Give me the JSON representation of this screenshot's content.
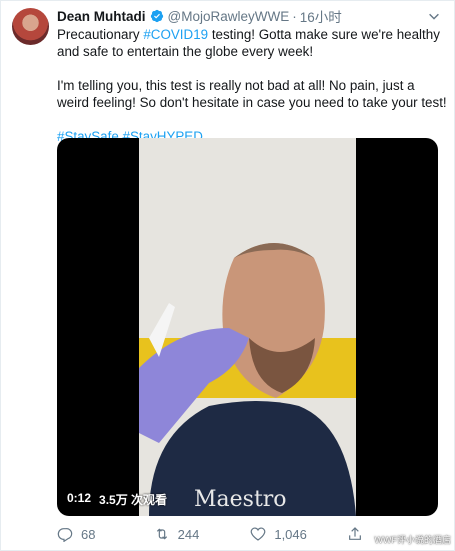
{
  "tweet": {
    "author_name": "Dean Muhtadi",
    "handle": "@MojoRawleyWWE",
    "separator": "·",
    "time": "16小时",
    "text": {
      "p1_before": "Precautionary ",
      "p1_hashtag": "#COVID19",
      "p1_after": " testing! Gotta make sure we're healthy and safe to entertain the globe every week!",
      "p2": "I'm telling you, this test is really not bad at all! No pain, just a weird feeling! So don't hesitate in case you need to take your test!",
      "hashtag1": "#StaySafe",
      "hashtag2": "#StayHYPED"
    }
  },
  "video": {
    "duration": "0:12",
    "views": "3.5万 次观看",
    "shirt_text": "Maestro"
  },
  "actions": {
    "replies": "68",
    "retweets": "244",
    "likes": "1,046"
  },
  "watermark": "WWF评小说的酒店",
  "colors": {
    "accent": "#1da1f2",
    "muted": "#657786"
  }
}
